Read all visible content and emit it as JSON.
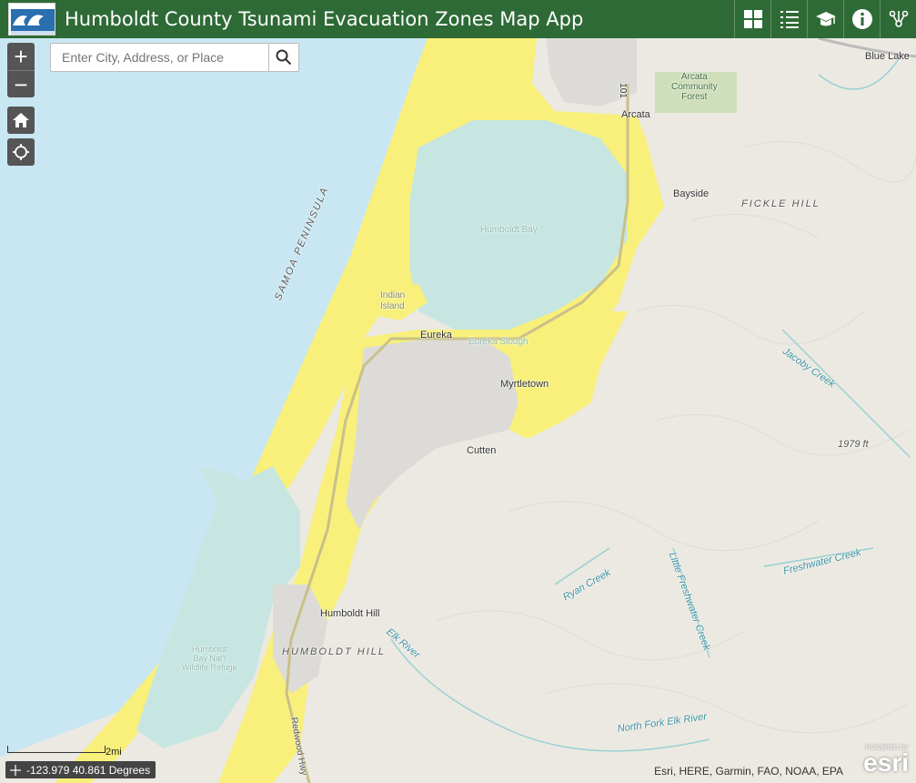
{
  "header": {
    "title": "Humboldt County Tsunami Evacuation Zones Map App",
    "bg_color": "#2e6a35"
  },
  "toolbar": [
    {
      "name": "overview-map",
      "icon": "grid-icon"
    },
    {
      "name": "legend",
      "icon": "list-icon"
    },
    {
      "name": "education",
      "icon": "graduation-cap-icon"
    },
    {
      "name": "about",
      "icon": "info-icon"
    },
    {
      "name": "share",
      "icon": "share-icon"
    }
  ],
  "search": {
    "placeholder": "Enter City, Address, or Place"
  },
  "zoom": {
    "in": "+",
    "out": "−"
  },
  "map_labels": {
    "blue_lake": "Blue Lake",
    "arcata_forest": "Arcata\nCommunity\nForest",
    "arcata": "Arcata",
    "hwy_101": "101",
    "bayside": "Bayside",
    "fickle_hill": "FICKLE HILL",
    "humboldt_bay": "Humboldt Bay",
    "samoa_peninsula": "SAMOA PENINSULA",
    "indian_island": "Indian\nIsland",
    "eureka": "Eureka",
    "eureka_slough": "Eureka Slough",
    "myrtletown": "Myrtletown",
    "jacoby_creek": "Jacoby Creek",
    "cutten": "Cutten",
    "elevation": "1979 ft",
    "freshwater_creek": "Freshwater Creek",
    "ryan_creek": "Ryan Creek",
    "little_freshwater_creek": "Little Freshwater Creek",
    "humboldt_hill_town": "Humboldt Hill",
    "humboldt_hill_area": "HUMBOLDT HILL",
    "elk_river": "Elk River",
    "refuge": "Humboldt\nBay Nat'l\nWildlife Refuge",
    "north_fork_elk_river": "North Fork Elk River",
    "redwood_hwy": "Redwood Hwy"
  },
  "scalebar": {
    "label": "2mi"
  },
  "coordinates": {
    "text": "-123.979 40.861 Degrees"
  },
  "attribution": "Esri, HERE, Garmin, FAO, NOAA, EPA",
  "esri_logo": {
    "top": "POWERED BY",
    "brand": "esri"
  },
  "colors": {
    "ocean": "#c9e7f2",
    "bay": "#c7e6e1",
    "land": "#ebe9e1",
    "zone": "#f8f07a",
    "urban": "#dcdbd8",
    "forest": "#cfdfbc",
    "creek": "#9ad0d4",
    "control": "#555555"
  }
}
